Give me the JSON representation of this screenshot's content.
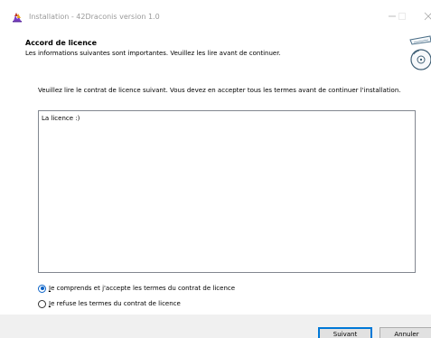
{
  "window": {
    "title": "Installation - 42Draconis version 1.0",
    "icon": "installer-app-icon"
  },
  "header": {
    "title": "Accord de licence",
    "subtitle": "Les informations suivantes sont importantes. Veuillez les lire avant de continuer.",
    "icon": "setup-disc-icon"
  },
  "main": {
    "instruction": "Veuillez lire le contrat de licence suivant. Vous devez en accepter tous les termes avant de continuer l'installation.",
    "license_text": "La licence :)"
  },
  "options": {
    "accept": {
      "underlined": "J",
      "rest": "e comprends et j'accepte les termes du contrat de licence",
      "checked": true
    },
    "decline": {
      "underlined": "J",
      "rest": "e refuse les termes du contrat de licence",
      "checked": false
    }
  },
  "buttons": {
    "next": "Suivant",
    "cancel": "Annuler"
  },
  "colors": {
    "radio_selected": "#0a62c7",
    "footer_bg": "#f0f0f0",
    "default_button_border": "#0078d7"
  }
}
